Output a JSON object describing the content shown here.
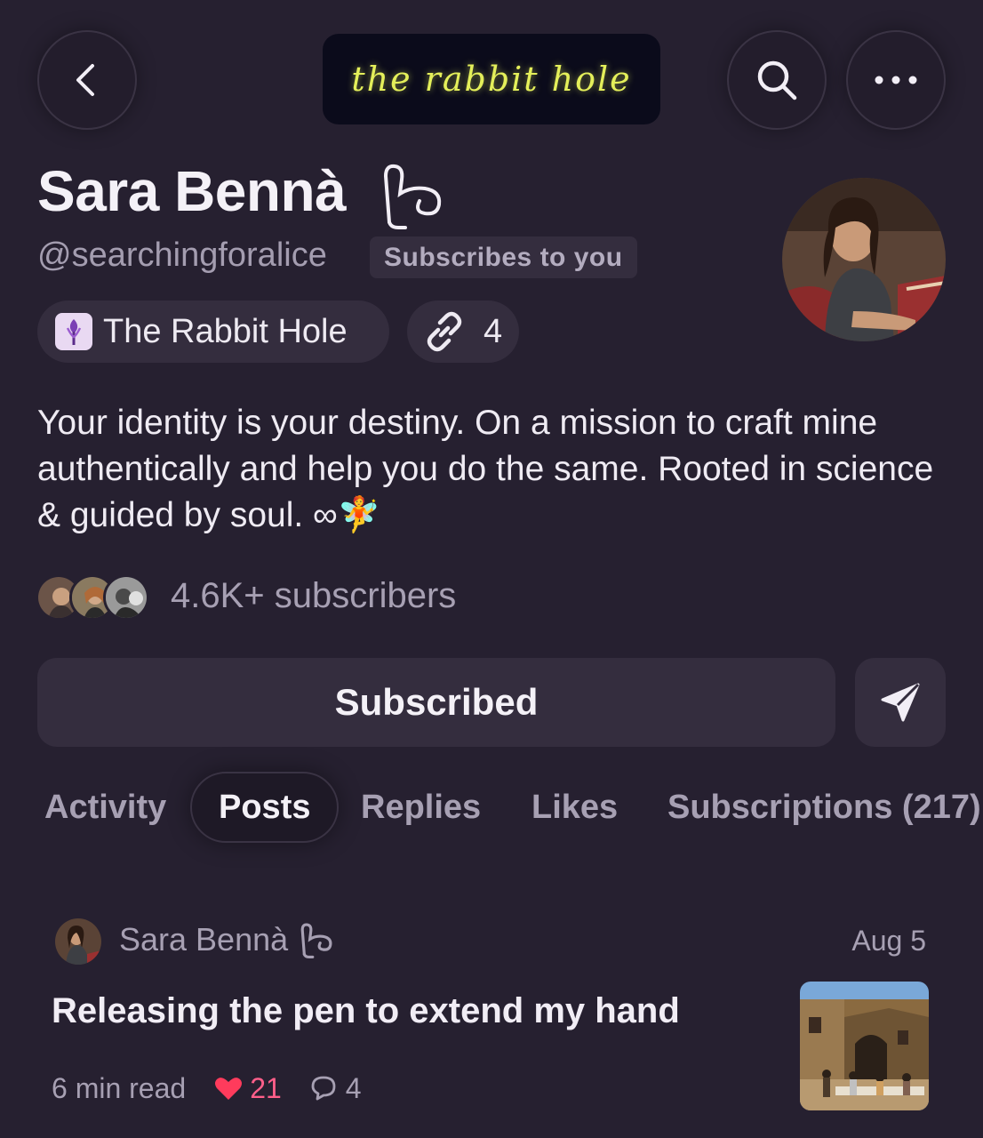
{
  "header": {
    "logo_text": "the rabbit hole",
    "icons": [
      "back-chevron-icon",
      "search-icon",
      "more-dots-icon"
    ]
  },
  "profile": {
    "name": "Sara Bennà",
    "handle": "@searchingforalice",
    "subscribes_badge": "Subscribes to you",
    "publication": "The Rabbit Hole",
    "links_count": "4",
    "bio": "Your identity is your destiny. On a mission to craft mine authentically and help you do the same. Rooted in science & guided by soul. ∞🧚",
    "subscribers": "4.6K+ subscribers",
    "subscribe_button": "Subscribed"
  },
  "tabs": [
    {
      "label": "Activity",
      "active": false
    },
    {
      "label": "Posts",
      "active": true
    },
    {
      "label": "Replies",
      "active": false
    },
    {
      "label": "Likes",
      "active": false
    },
    {
      "label": "Subscriptions (217)",
      "active": false
    }
  ],
  "post": {
    "author": "Sara Bennà",
    "date": "Aug 5",
    "title": "Releasing the pen to extend my hand",
    "read_time": "6 min read",
    "likes": "21",
    "comments": "4"
  },
  "colors": {
    "background": "#262030",
    "surface": "#342d3e",
    "heart": "#ff3b5c",
    "logo": "#e4ef5a"
  }
}
